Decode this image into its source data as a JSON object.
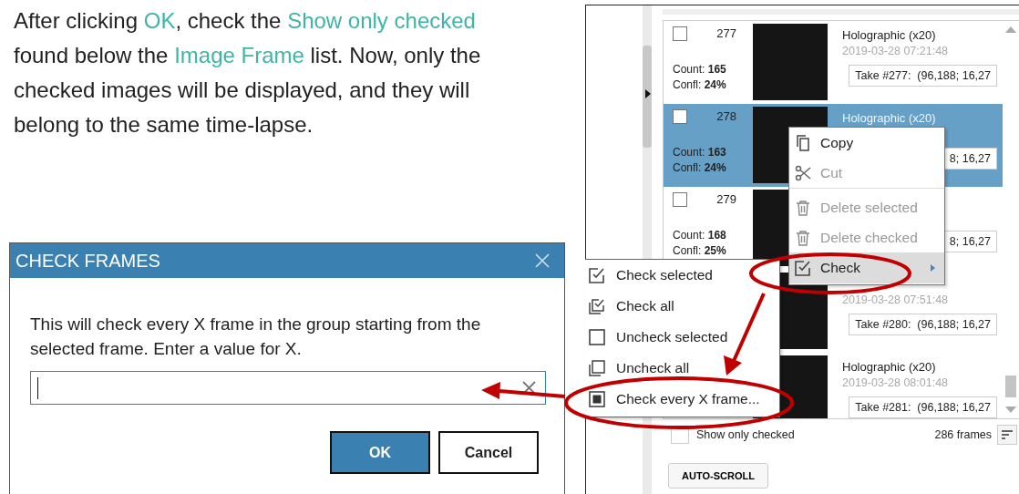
{
  "instruction": {
    "segments": [
      {
        "text": "After clicking ",
        "highlight": false
      },
      {
        "text": "OK",
        "highlight": true
      },
      {
        "text": ", check the ",
        "highlight": false
      },
      {
        "text": "Show only checked",
        "highlight": true
      },
      {
        "text": " found below the ",
        "highlight": false
      },
      {
        "text": "Image Frame",
        "highlight": true
      },
      {
        "text": " list. Now, only the checked images will be displayed, and they will belong to the same time-lapse.",
        "highlight": false
      }
    ]
  },
  "dialog": {
    "title": "CHECK FRAMES",
    "message": "This will check every X frame in the group starting from the selected frame. Enter a value for X.",
    "buttons": [
      {
        "label": "OK",
        "primary": true
      },
      {
        "label": "Cancel",
        "primary": false
      }
    ]
  },
  "frame_list": {
    "rows": [
      {
        "selected": false,
        "checked": false,
        "number": "277",
        "count": "Count: **165**",
        "confluence": "Confl: **24%**",
        "title": "Holographic (x20)",
        "date": "2019-03-28 07:21:48",
        "take": "Take #277:  (96,188; 16,27"
      },
      {
        "selected": true,
        "checked": false,
        "number": "278",
        "count": "Count: **163**",
        "confluence": "Confl: **24%**",
        "title": "Holographic (x20)",
        "take": "8; 16,27"
      },
      {
        "selected": false,
        "checked": false,
        "number": "279",
        "count": "Count: **168**",
        "confluence": "Confl: **25%**",
        "take": "8; 16,27"
      },
      {
        "selected": false,
        "date": "2019-03-28 07:51:48",
        "take": "Take #280:  (96,188; 16,27"
      },
      {
        "selected": false,
        "title": "Holographic (x20)",
        "date": "2019-03-28 08:01:48",
        "take": "Take #281:  (96,188; 16,27"
      }
    ],
    "show_only_checked": {
      "label": "Show only checked",
      "checked": false
    },
    "frame_count": "286 frames",
    "auto_scroll": "AUTO-SCROLL"
  },
  "context_menu": {
    "items": [
      {
        "kind": "copy",
        "label": "Copy",
        "disabled": false,
        "highlighted": false,
        "submenu": false,
        "separator_after": false
      },
      {
        "kind": "cut",
        "label": "Cut",
        "disabled": true,
        "highlighted": false,
        "submenu": false,
        "separator_after": true
      },
      {
        "kind": "delete",
        "label": "Delete selected",
        "disabled": true,
        "highlighted": false,
        "submenu": false,
        "separator_after": false
      },
      {
        "kind": "delete",
        "label": "Delete checked",
        "disabled": true,
        "highlighted": false,
        "submenu": false,
        "separator_after": false
      },
      {
        "kind": "check",
        "label": "Check",
        "disabled": false,
        "highlighted": true,
        "submenu": true,
        "separator_after": false
      }
    ]
  },
  "check_submenu": {
    "items": [
      {
        "kind": "check",
        "label": "Check selected"
      },
      {
        "kind": "check-all",
        "label": "Check all"
      },
      {
        "kind": "uncheck",
        "label": "Uncheck selected"
      },
      {
        "kind": "uncheck-all",
        "label": "Uncheck all"
      },
      {
        "kind": "filled",
        "label": "Check every X frame..."
      }
    ]
  }
}
